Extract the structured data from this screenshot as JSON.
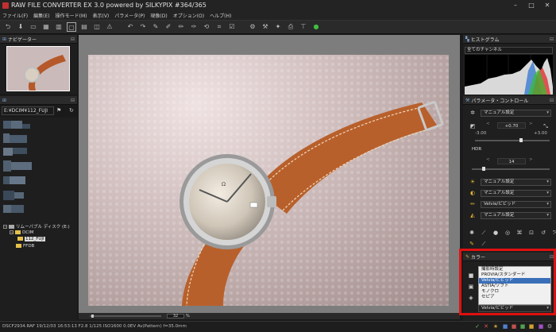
{
  "window": {
    "title": "RAW FILE CONVERTER EX 3.0 powered by SILKYPIX    #364/365",
    "min": "–",
    "max": "□",
    "close": "✕"
  },
  "menu": [
    "ファイル(F)",
    "編集(E)",
    "操作モード(M)",
    "表示(V)",
    "パラメータ(P)",
    "現像(D)",
    "オプション(O)",
    "ヘルプ(H)"
  ],
  "toolbar": {
    "icons": [
      "open-folder",
      "save",
      "single-view",
      "grid-view",
      "compare",
      "full-view",
      "thumb-view",
      "split-view",
      "warning",
      "undo",
      "redo",
      "pen1",
      "pen2",
      "pen3",
      "pen4",
      "pen5",
      "crop",
      "develop-a",
      "develop-b",
      "develop-c",
      "batch",
      "stamp",
      "done"
    ]
  },
  "navigator": {
    "header": "ナビゲーター"
  },
  "folder": {
    "path": "E:¥DCIM¥112_FUJI",
    "tree": [
      {
        "label": "リムーバブル ディスク (E:)",
        "level": 0
      },
      {
        "label": "DCIM",
        "level": 1
      },
      {
        "label": "112_FUJI",
        "level": 2,
        "selected": true
      },
      {
        "label": "FFDB",
        "level": 1
      }
    ]
  },
  "viewer": {
    "zoom": "32",
    "zoom_unit": "%"
  },
  "footer": {
    "info": "DSCF2934.RAF 19/12/03 16:53:13 F2.8 1/125 ISO1600  0.0EV Av(Pattern) f=35.0mm"
  },
  "histogram": {
    "header": "ヒストグラム",
    "channel": "全てのチャンネル"
  },
  "params": {
    "header": "パラメータ・コントロール",
    "wb_mode": "マニュアル設定",
    "exposure_value": "+0.70",
    "exposure_min": "-3.00",
    "exposure_max": "+3.00",
    "exposure_level": 0.62,
    "hdr_label": "HDR",
    "hdr_value": "14",
    "hdr_level": 0.14,
    "tone1": "マニュアル設定",
    "tone2": "マニュアル設定",
    "color": "Velvia/ビビッド",
    "sharp": "マニュアル設定"
  },
  "color_panel": {
    "header": "カラー",
    "options": [
      "撮影時設定",
      "PROVIA/スタンダード",
      "Velvia/ビビッド",
      "ASTIA/ソフト",
      "モノクロ",
      "セピア"
    ],
    "selected": "Velvia/ビビッド"
  },
  "colors": {
    "accent": "#3a6fb8",
    "highlight": "#e01010",
    "folder": "#e6c04a"
  }
}
